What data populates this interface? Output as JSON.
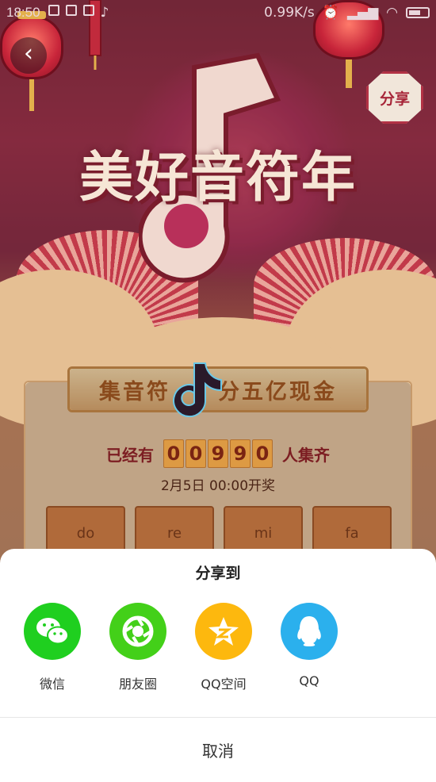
{
  "status_bar": {
    "time": "18:50",
    "network_speed": "0.99K/s",
    "icons": [
      "lock-icon",
      "image-icon",
      "image-icon",
      "tiktok-icon",
      "alarm-icon",
      "signal-icon",
      "wifi-icon",
      "battery-icon"
    ]
  },
  "promo": {
    "title": "美好音符年",
    "share_badge": "分享",
    "banner_left": "集音符",
    "banner_right": "分五亿现金",
    "count_prefix": "已经有",
    "count_digits": [
      "0",
      "0",
      "9",
      "9",
      "0"
    ],
    "count_suffix": "人集齐",
    "draw_time": "2月5日 00:00开奖",
    "note_slots": [
      "do",
      "re",
      "mi",
      "fa"
    ]
  },
  "share_sheet": {
    "title": "分享到",
    "targets": [
      {
        "label": "微信",
        "icon": "wechat-icon",
        "color": "#1fcf1f"
      },
      {
        "label": "朋友圈",
        "icon": "moments-icon",
        "color": "#43d019"
      },
      {
        "label": "QQ空间",
        "icon": "qzone-icon",
        "color": "#fdb80e"
      },
      {
        "label": "QQ",
        "icon": "qq-icon",
        "color": "#2bb0ed"
      }
    ],
    "cancel": "取消"
  }
}
